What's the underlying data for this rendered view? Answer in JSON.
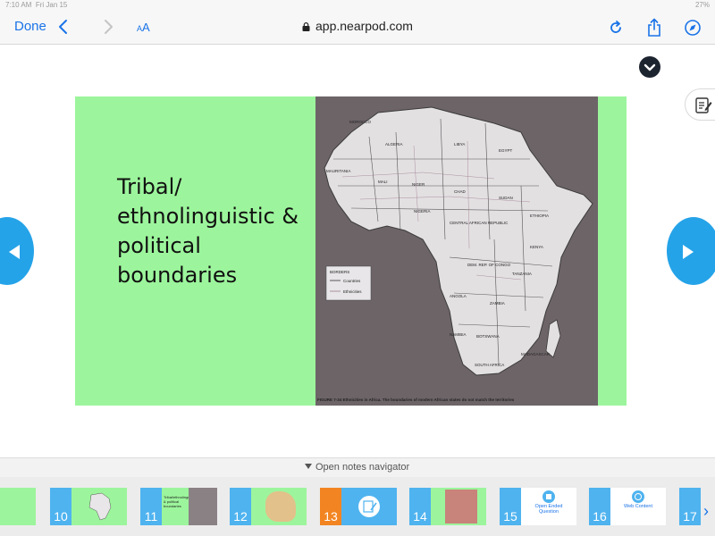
{
  "status_bar": {
    "time": "7:10 AM",
    "date": "Fri Jan 15",
    "battery": "27%"
  },
  "toolbar": {
    "done_label": "Done",
    "aa_small": "A",
    "aa_large": "A",
    "url": "app.nearpod.com"
  },
  "slide": {
    "title_lines": [
      "Tribal/",
      "ethnolinguistic &",
      "political",
      "boundaries"
    ],
    "map_caption": "FIGURE 7-34  Ethnicities in Africa. The boundaries of modern African states do not match the territories",
    "map_labels": {
      "morocco": "MOROCCO",
      "algeria": "ALGERIA",
      "libya": "LIBYA",
      "egypt": "EGYPT",
      "mauritania": "MAURITANIA",
      "mali": "MALI",
      "niger": "NIGER",
      "chad": "CHAD",
      "sudan": "SUDAN",
      "ethiopia": "ETHIOPIA",
      "nigeria": "NIGERIA",
      "car": "CENTRAL AFRICAN REPUBLIC",
      "kenya": "KENYA",
      "drc": "DEM. REP. OF CONGO",
      "tanzania": "TANZANIA",
      "angola": "ANGOLA",
      "zambia": "ZAMBIA",
      "namibia": "NAMIBIA",
      "botswana": "BOTSWANA",
      "south_africa": "SOUTH AFRICA",
      "madagascar": "MADAGASCAR",
      "legend_title": "BORDERS",
      "legend_countries": "Countries",
      "legend_ethnicities": "Ethnicities"
    }
  },
  "notes_navigator": {
    "label": "Open notes navigator"
  },
  "thumbnails": [
    {
      "number": "10",
      "caption": ""
    },
    {
      "number": "11",
      "caption": "Tribal/ethnolinguistic & political boundaries"
    },
    {
      "number": "12",
      "caption": ""
    },
    {
      "number": "13",
      "caption": ""
    },
    {
      "number": "14",
      "caption": ""
    },
    {
      "number": "15",
      "caption": "Open Ended Question"
    },
    {
      "number": "16",
      "caption": "Web Content"
    },
    {
      "number": "17",
      "caption": ""
    }
  ],
  "colors": {
    "accent": "#1a73e8",
    "slide_bg": "#9cf59c",
    "nav_button": "#25a3e8",
    "active_thumb": "#f28522"
  }
}
